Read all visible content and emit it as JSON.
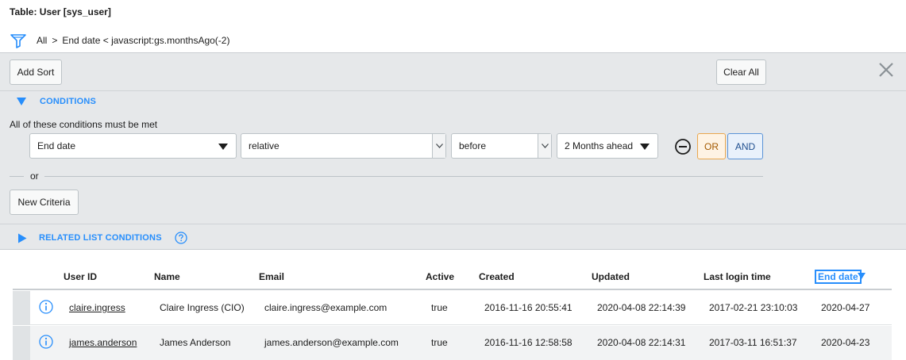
{
  "header": {
    "title": "Table: User [sys_user]",
    "breadcrumb": {
      "root": "All",
      "separator": ">",
      "condition": "End date < javascript:gs.monthsAgo(-2)"
    }
  },
  "toolbar": {
    "add_sort": "Add Sort",
    "clear_all": "Clear All"
  },
  "conditions": {
    "heading": "CONDITIONS",
    "met_text": "All of these conditions must be met",
    "field": "End date",
    "operator": "relative",
    "direction": "before",
    "value": "2 Months ahead",
    "or_label": "OR",
    "and_label": "AND",
    "or_divider": "or",
    "new_criteria": "New Criteria"
  },
  "related": {
    "heading": "RELATED LIST CONDITIONS"
  },
  "table": {
    "columns": [
      "User ID",
      "Name",
      "Email",
      "Active",
      "Created",
      "Updated",
      "Last login time",
      "End date"
    ],
    "sorted_column": "End date",
    "rows": [
      {
        "user_id": "claire.ingress",
        "name": "Claire Ingress (CIO)",
        "email": "claire.ingress@example.com",
        "active": "true",
        "created": "2016-11-16 20:55:41",
        "updated": "2020-04-08 22:14:39",
        "last_login": "2017-02-21 23:10:03",
        "end_date": "2020-04-27"
      },
      {
        "user_id": "james.anderson",
        "name": "James Anderson",
        "email": "james.anderson@example.com",
        "active": "true",
        "created": "2016-11-16 12:58:58",
        "updated": "2020-04-08 22:14:31",
        "last_login": "2017-03-11 16:51:37",
        "end_date": "2020-04-23"
      }
    ]
  },
  "colors": {
    "accent": "#278efc",
    "or_border": "#e9a74f",
    "and_border": "#5b93d6",
    "panel_bg": "#e6e8ea"
  },
  "icons": [
    "filter-icon",
    "close-icon",
    "collapse-triangle-icon",
    "expand-triangle-icon",
    "help-icon",
    "remove-condition-icon",
    "info-icon",
    "sort-desc-icon"
  ]
}
